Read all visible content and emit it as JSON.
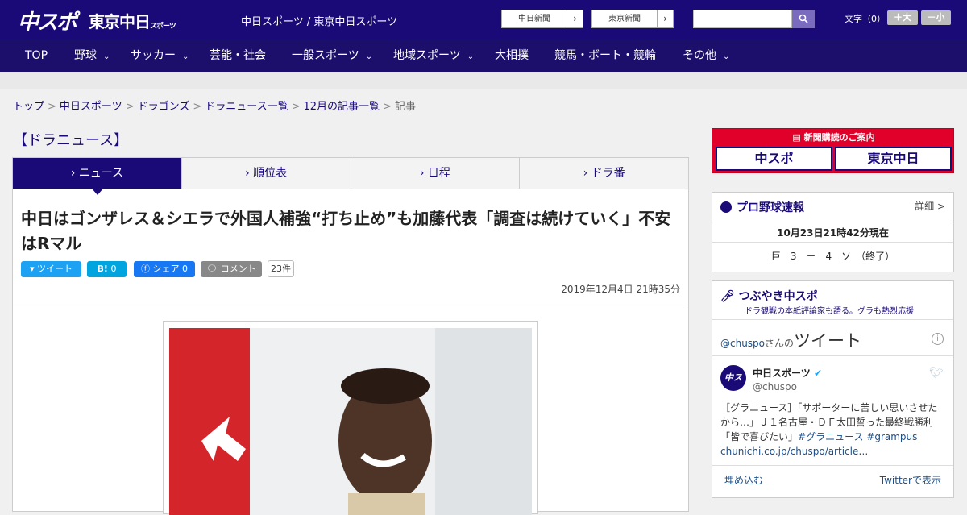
{
  "header": {
    "logo_chuspo": "中スポ",
    "logo_tokyo": "東京中日",
    "logo_tokyo_small": "スポーツ",
    "site_title": "中日スポーツ / 東京中日スポーツ",
    "link_chunichi": "中日新聞",
    "link_tokyo": "東京新聞",
    "arrow": "›",
    "font_size_label": "文字（0）",
    "font_plus": "＋大",
    "font_minus": "－小"
  },
  "nav": [
    {
      "label": "TOP"
    },
    {
      "label": "野球",
      "dd": "⌄"
    },
    {
      "label": "サッカー",
      "dd": "⌄"
    },
    {
      "label": "芸能・社会"
    },
    {
      "label": "一般スポーツ",
      "dd": "⌄"
    },
    {
      "label": "地域スポーツ",
      "dd": "⌄"
    },
    {
      "label": "大相撲"
    },
    {
      "label": "競馬・ボート・競輪"
    },
    {
      "label": "その他",
      "dd": "⌄"
    }
  ],
  "breadcrumb": {
    "items": [
      "トップ",
      "中日スポーツ",
      "ドラゴンズ",
      "ドラニュース一覧",
      "12月の記事一覧",
      "記事"
    ],
    "separator": ">"
  },
  "section_heading": "【ドラニュース】",
  "tabs": [
    "ニュース",
    "順位表",
    "日程",
    "ドラ番"
  ],
  "tab_marker": "›",
  "article": {
    "title": "中日はゴンザレス＆シエラで外国人補強“打ち止め”も加藤代表「調査は続けていく」不安はRマル",
    "date": "2019年12月4日 21時35分",
    "tweet": "ツイート",
    "hatena": "B!",
    "hatena_count": "0",
    "share": "シェア 0",
    "comment": "コメント",
    "comment_count": "23件"
  },
  "sidebar": {
    "subscribe": {
      "title": "新聞購読のご案内",
      "paper1": "中スポ",
      "paper2": "東京中日"
    },
    "baseball": {
      "title": "プロ野球速報",
      "more": "詳細 >",
      "time": "10月23日21時42分現在",
      "score": "巨　3　－　4　ソ　（終了）"
    },
    "tsubuyaki": {
      "title": "つぶやき中スポ",
      "subtitle": "ドラ観戦の本紙評論家も語る。グラも熱烈応援",
      "handle": "@chuspo",
      "handle_suffix": "さんの",
      "tweet_word": "ツイート",
      "account_name": "中日スポーツ",
      "account_handle": "@chuspo",
      "tweet_text": "［グラニュース］「サポーターに苦しい思いさせたから…」Ｊ１名古屋・ＤＦ太田誓った最終戦勝利「皆で喜びたい」",
      "hashtags": "#グラニュース #grampus",
      "tweet_link": "chunichi.co.jp/chuspo/article…",
      "embed": "埋め込む",
      "view_on_twitter": "Twitterで表示"
    }
  },
  "colors": {
    "brand": "#1a0a78",
    "accent": "#e1002a",
    "twitter": "#1da1f2",
    "facebook": "#1877f2",
    "hatena": "#00a4de"
  }
}
